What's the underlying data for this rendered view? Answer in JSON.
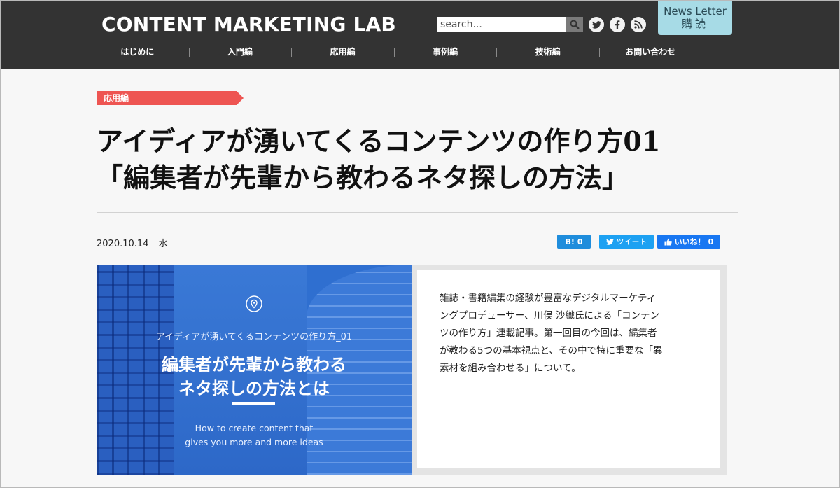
{
  "header": {
    "logo": "CONTENT MARKETING LAB",
    "search_placeholder": "search...",
    "newsletter_line1": "News Letter",
    "newsletter_line2": "購読",
    "nav": [
      "はじめに",
      "入門編",
      "応用編",
      "事例編",
      "技術編",
      "お問い合わせ"
    ]
  },
  "article": {
    "category": "応用編",
    "title_lines": [
      "アイディアが湧いてくるコンテンツの作り方01",
      "「編集者が先輩から教わるネタ探しの方法」"
    ],
    "date": "2020.10.14",
    "day_of_week": "水",
    "share": {
      "hatena": "B!",
      "hatena_count": "0",
      "tweet": "ツイート",
      "like": "いいね！",
      "like_count": "0"
    },
    "hero": {
      "subtitle": "アイディアが湧いてくるコンテンツの作り方_01",
      "headline_lines": [
        "編集者が先輩から教わる",
        "ネタ探しの方法とは"
      ],
      "english_lines": [
        "How to create content that",
        "gives you more and more ideas"
      ]
    },
    "excerpt_lines": [
      "雑誌・書籍編集の経験が豊富なデジタルマーケティ",
      "ングプロデューサー、川俣 沙織氏による「コンテン",
      "ツの作り方」連載記事。第一回目の今回は、編集者",
      "が教わる5つの基本視点と、その中で特に重要な「異",
      "素材を組み合わせる」について。"
    ]
  },
  "colors": {
    "header_bg": "#333333",
    "newsletter_bg": "#a7dbe6",
    "category_bg": "#ee5552",
    "hero_blue": "#2f6fd0"
  }
}
